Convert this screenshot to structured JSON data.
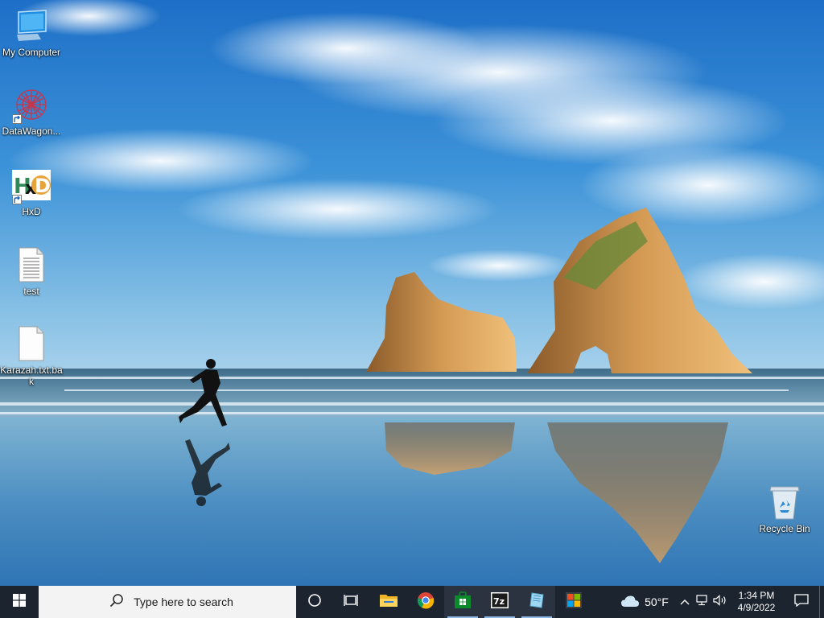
{
  "desktop": {
    "icons": [
      {
        "label": "My Computer",
        "icon": "monitor-icon",
        "shortcut": false
      },
      {
        "label": "DataWagon...",
        "icon": "datawagon-icon",
        "shortcut": true
      },
      {
        "label": "HxD",
        "icon": "hxd-icon",
        "shortcut": true
      },
      {
        "label": "test",
        "icon": "text-document-icon",
        "shortcut": false
      },
      {
        "label": "Karazah.txt.bak",
        "icon": "blank-document-icon",
        "shortcut": false
      },
      {
        "label": "Recycle Bin",
        "icon": "recycle-bin-icon",
        "shortcut": false
      }
    ]
  },
  "taskbar": {
    "start_icon": "windows-logo-icon",
    "search_placeholder": "Type here to search",
    "pinned": [
      {
        "name": "cortana",
        "icon": "circle-icon"
      },
      {
        "name": "task-view",
        "icon": "task-view-icon"
      },
      {
        "name": "file-explorer",
        "icon": "folder-icon"
      },
      {
        "name": "chrome",
        "icon": "chrome-icon"
      },
      {
        "name": "store",
        "icon": "store-icon"
      },
      {
        "name": "7zip",
        "icon": "7zip-icon",
        "badge": "7z"
      },
      {
        "name": "notepad",
        "icon": "notepad-icon"
      },
      {
        "name": "microsoft",
        "icon": "microsoft-logo-icon"
      }
    ],
    "weather": {
      "temp": "50°F",
      "icon": "cloud-icon"
    },
    "clock": {
      "time": "1:34 PM",
      "date": "4/9/2022"
    }
  },
  "colors": {
    "taskbar": "#1c2430",
    "search_bg": "#f3f3f3",
    "active_indicator": "#8fb8e6"
  }
}
